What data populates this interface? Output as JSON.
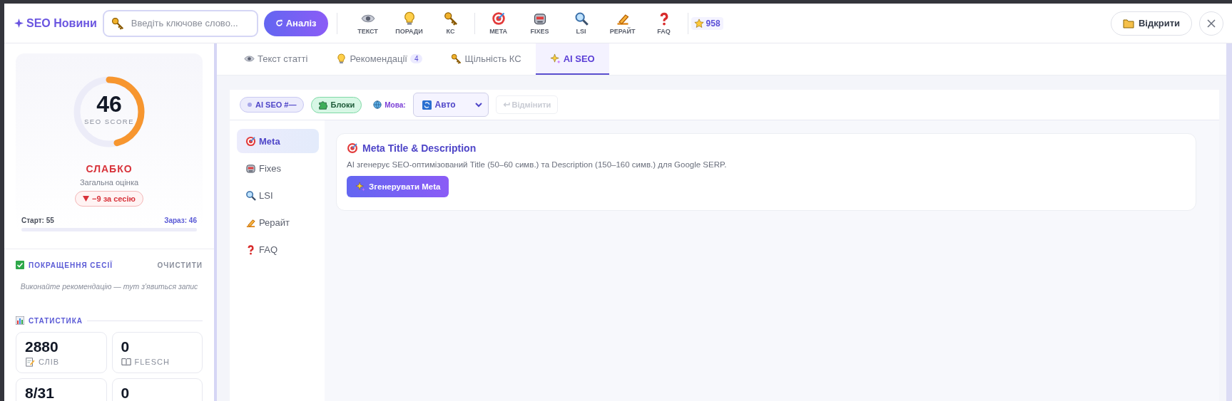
{
  "header": {
    "logo": "SEO Новини",
    "search": {
      "placeholder": "Введіть ключове слово..."
    },
    "analyze_button": "Аналіз",
    "toolbar_groups": [
      [
        {
          "label": "ТЕКСТ",
          "kind": "eye"
        },
        {
          "label": "ПОРАДИ",
          "kind": "bulb"
        },
        {
          "label": "КС",
          "kind": "key"
        }
      ],
      [
        {
          "label": "META",
          "kind": "target"
        },
        {
          "label": "FIXES",
          "kind": "robot"
        },
        {
          "label": "LSI",
          "kind": "magnifier"
        },
        {
          "label": "РЕРАЙТ",
          "kind": "pencil"
        },
        {
          "label": "FAQ",
          "kind": "question"
        }
      ]
    ],
    "points": "958",
    "open_button": "Відкрити"
  },
  "sidebar": {
    "score": {
      "value": "46",
      "label": "SEO SCORE",
      "level": 0.46,
      "rating": "СЛАБКО",
      "subtitle": "Загальна оцінка",
      "delta": "−9 за сесію",
      "start": "Старт: 55",
      "now": "Зараз: 46"
    },
    "session": {
      "title": "ПОКРАЩЕННЯ СЕСІЇ",
      "clear": "ОЧИСТИТИ",
      "empty": "Виконайте рекомендацію — тут з'явиться запис"
    },
    "stats": {
      "title": "СТАТИСТИКА",
      "cards": [
        {
          "value": "2880",
          "label": "СЛІВ",
          "kind": "memo"
        },
        {
          "value": "0",
          "label": "FLESCH",
          "kind": "book"
        },
        {
          "value": "8/31"
        },
        {
          "value": "0"
        }
      ]
    }
  },
  "tabs": [
    {
      "label": "Текст статті",
      "kind": "eye",
      "selected": false
    },
    {
      "label": "Рекомендації",
      "kind": "bulb",
      "badge": "4",
      "selected": false
    },
    {
      "label": "Щільність КС",
      "kind": "key",
      "selected": false
    },
    {
      "label": "AI SEO",
      "kind": "sparkles",
      "selected": true
    }
  ],
  "ai_toolbar": {
    "chip": "AI SEO #—",
    "blocks": "Блоки",
    "language_label": "Мова:",
    "language_value": "Авто",
    "undo": "Відмінити",
    "undo_disabled": true
  },
  "sections": [
    {
      "label": "Meta",
      "kind": "target",
      "selected": true
    },
    {
      "label": "Fixes",
      "kind": "robot",
      "selected": false
    },
    {
      "label": "LSI",
      "kind": "magnifier",
      "selected": false
    },
    {
      "label": "Рерайт",
      "kind": "pencil",
      "selected": false
    },
    {
      "label": "FAQ",
      "kind": "question",
      "selected": false
    }
  ],
  "panel": {
    "title": "Meta Title & Description",
    "kind": "target",
    "description": "AI згенерує SEO-оптимізований Title (50–60 симв.) та Description (150–160 симв.) для Google SERP.",
    "button": "Згенерувати Meta"
  }
}
